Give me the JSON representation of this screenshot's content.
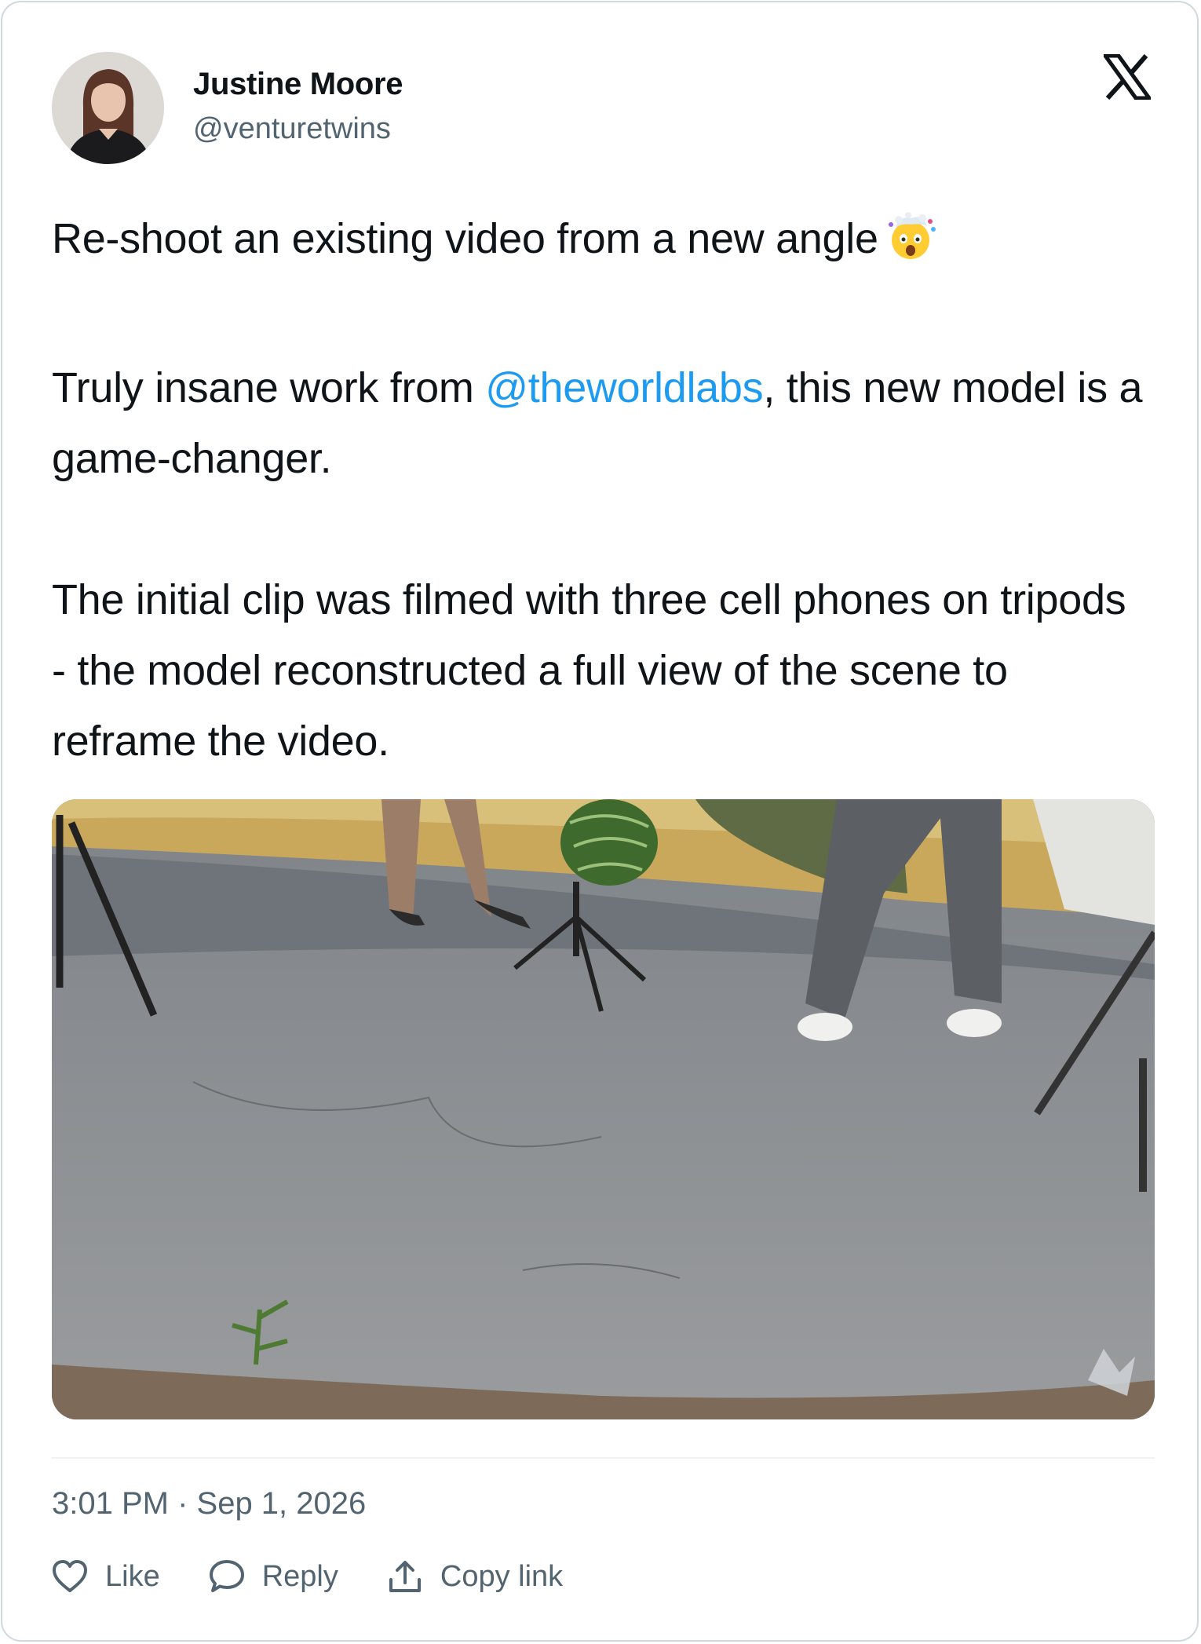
{
  "author": {
    "name": "Justine Moore",
    "handle": "@venturetwins"
  },
  "tweet": {
    "line1": "Re-shoot an existing video from a new angle",
    "line1_emoji": "exploding-head-emoji",
    "para2_before": "Truly insane work from ",
    "para2_mention": "@theworldlabs",
    "para2_after": ", this new model is a game-changer.",
    "para3": "The initial clip was filmed with three cell phones on tripods - the model reconstructed a full view of the scene to reframe the video."
  },
  "timestamp": "3:01 PM · Sep 1, 2026",
  "actions": {
    "like": "Like",
    "reply": "Reply",
    "copy_link": "Copy link"
  },
  "colors": {
    "mention": "#1d9bf0",
    "secondary_text": "#536471",
    "border": "#cfd9de"
  },
  "icons": {
    "brand": "x-logo-icon",
    "like": "heart-icon",
    "reply": "speech-bubble-icon",
    "copy_link": "share-upload-icon"
  }
}
